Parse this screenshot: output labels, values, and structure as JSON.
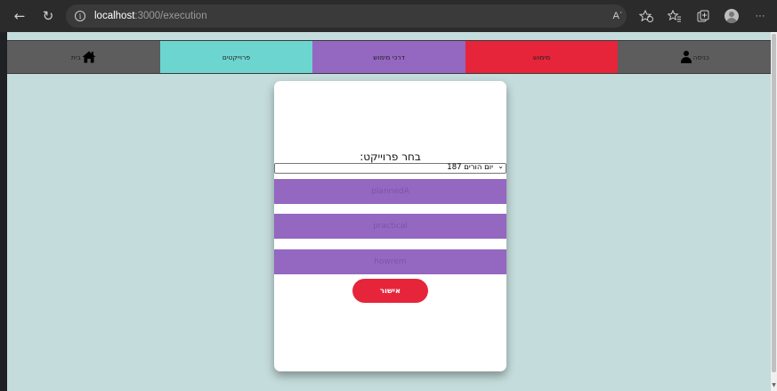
{
  "browser": {
    "url_host": "localhost",
    "url_path": ":3000/execution",
    "read_aloud_label": "Aʾ"
  },
  "appnav": {
    "items": [
      {
        "id": "login",
        "label": "כניסה",
        "icon": "user-icon",
        "color": "#5d5d5d"
      },
      {
        "id": "execution",
        "label": "מימוש",
        "color": "#e6253b"
      },
      {
        "id": "methods",
        "label": "דרכי מימוש",
        "color": "#9467c1"
      },
      {
        "id": "projects",
        "label": "פרוייקטים",
        "color": "#6dd5d0"
      },
      {
        "id": "home",
        "label": "בית",
        "icon": "home-icon",
        "color": "#5d5d5d"
      }
    ]
  },
  "form": {
    "select_label": "בחר פרוייקט:",
    "selected_project": "יום הורים 187",
    "fields": [
      {
        "placeholder": "plannedA"
      },
      {
        "placeholder": "practical"
      },
      {
        "placeholder": "howrem"
      }
    ],
    "submit_label": "אישור"
  },
  "colors": {
    "page_background": "#c4dcdb",
    "purple": "#9467c1",
    "red": "#e6253b",
    "teal": "#6dd5d0",
    "gray": "#5d5d5d"
  }
}
